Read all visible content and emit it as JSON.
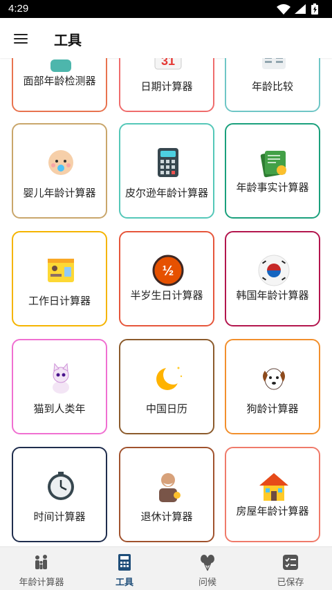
{
  "status_bar": {
    "time": "4:29"
  },
  "app_bar": {
    "title": "工具"
  },
  "tools": [
    {
      "label": "面部年龄检测器",
      "icon": "face-age-detector-icon",
      "border_color": "#e8734f"
    },
    {
      "label": "日期计算器",
      "icon": "calendar-icon",
      "border_color": "#ef6c6c"
    },
    {
      "label": "年龄比较",
      "icon": "age-compare-icon",
      "border_color": "#6fc6c6"
    },
    {
      "label": "婴儿年龄计算器",
      "icon": "baby-face-icon",
      "border_color": "#c9a66b"
    },
    {
      "label": "皮尔逊年龄计算器",
      "icon": "calculator-icon",
      "border_color": "#54c7b8"
    },
    {
      "label": "年龄事实计算器",
      "icon": "certificate-icon",
      "border_color": "#1aa07c"
    },
    {
      "label": "工作日计算器",
      "icon": "work-calendar-icon",
      "border_color": "#f5b400"
    },
    {
      "label": "半岁生日计算器",
      "icon": "half-icon",
      "border_color": "#e6553a"
    },
    {
      "label": "韩国年龄计算器",
      "icon": "korea-flag-icon",
      "border_color": "#b3154d"
    },
    {
      "label": "猫到人类年",
      "icon": "cat-icon",
      "border_color": "#f06fd1"
    },
    {
      "label": "中国日历",
      "icon": "crescent-moon-icon",
      "border_color": "#8b5a2b"
    },
    {
      "label": "狗龄计算器",
      "icon": "dog-icon",
      "border_color": "#f28f2c"
    },
    {
      "label": "时间计算器",
      "icon": "clock-icon",
      "border_color": "#1f2d4d"
    },
    {
      "label": "退休计算器",
      "icon": "retiree-icon",
      "border_color": "#a0522d"
    },
    {
      "label": "房屋年龄计算器",
      "icon": "house-icon",
      "border_color": "#ef7a6a"
    }
  ],
  "bottom_nav": [
    {
      "label": "年龄计算器",
      "icon": "family-icon",
      "active": false
    },
    {
      "label": "工具",
      "icon": "calculator-icon",
      "active": true
    },
    {
      "label": "问候",
      "icon": "balloons-icon",
      "active": false
    },
    {
      "label": "已保存",
      "icon": "checklist-icon",
      "active": false
    }
  ],
  "colors": {
    "active_nav": "#1f4e79",
    "nav_background": "#f2f2f2"
  }
}
